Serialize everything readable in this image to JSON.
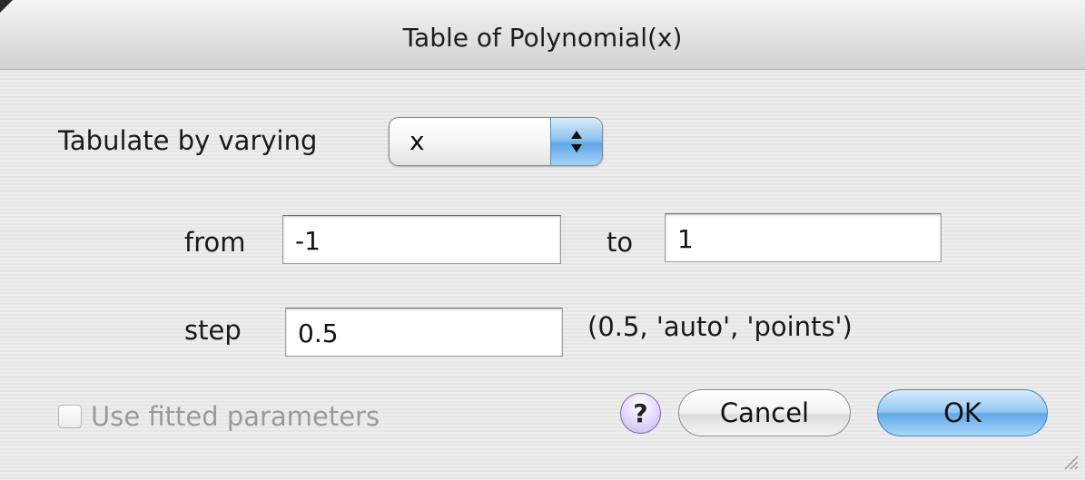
{
  "window": {
    "title": "Table of Polynomial(x)"
  },
  "vary": {
    "label": "Tabulate by varying",
    "selected": "x"
  },
  "range": {
    "from_label": "from",
    "from_value": "-1",
    "to_label": "to",
    "to_value": "1"
  },
  "step": {
    "label": "step",
    "value": "0.5",
    "hint": "(0.5, 'auto', 'points')"
  },
  "options": {
    "use_fitted_label": "Use fitted parameters",
    "use_fitted_checked": false,
    "use_fitted_enabled": false
  },
  "buttons": {
    "help_label": "?",
    "cancel_label": "Cancel",
    "ok_label": "OK"
  },
  "colors": {
    "accent": "#62a9e9",
    "help": "#c7b6f0",
    "disabled_text": "#9a9a9a"
  }
}
